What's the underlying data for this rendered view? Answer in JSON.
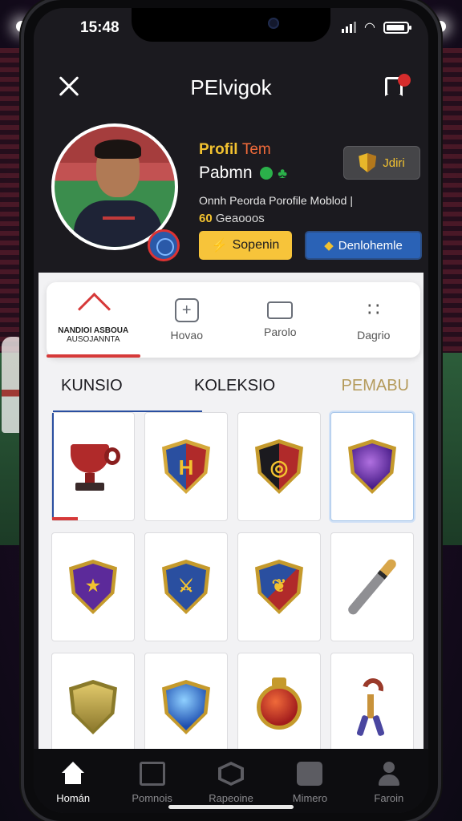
{
  "status_bar": {
    "time": "15:48"
  },
  "header": {
    "title": "PElvigok"
  },
  "profile": {
    "title_a": "Profil",
    "title_b": "Tem",
    "name": "Pabmn",
    "description": "Onnh Peorda Porofile Moblod |",
    "count_value": "60",
    "count_label": "Geaooos",
    "team_button": "Jdiri",
    "primary_button": "Sopenin",
    "secondary_button": "Denlohemle"
  },
  "tabs": [
    {
      "line1": "NANDIOI ASBOUA",
      "line2": "AUSOJANNTA",
      "icon": "house-icon"
    },
    {
      "label": "Hovao",
      "icon": "plus-box-icon"
    },
    {
      "label": "Parolo",
      "icon": "card-icon"
    },
    {
      "label": "Dagrio",
      "icon": "dots-icon"
    }
  ],
  "segments": [
    "KUNSIO",
    "KOLEKSIO",
    "PEMABU"
  ],
  "collection": [
    {
      "name": "red-cup-trophy"
    },
    {
      "name": "gold-h-shield"
    },
    {
      "name": "crest-shield"
    },
    {
      "name": "purple-orb-crest"
    },
    {
      "name": "purple-laurel-shield"
    },
    {
      "name": "blue-sword-shield"
    },
    {
      "name": "red-blue-shield"
    },
    {
      "name": "bronze-baton"
    },
    {
      "name": "gold-shield"
    },
    {
      "name": "blue-crystal-shield"
    },
    {
      "name": "red-orb-amulet"
    },
    {
      "name": "hook-staff"
    }
  ],
  "bottom_nav": [
    {
      "label": "Homán",
      "icon": "home-icon"
    },
    {
      "label": "Pomnois",
      "icon": "box-icon"
    },
    {
      "label": "Rapeoine",
      "icon": "hexagon-icon"
    },
    {
      "label": "Mimero",
      "icon": "bag-icon"
    },
    {
      "label": "Faroin",
      "icon": "user-icon"
    }
  ],
  "colors": {
    "accent_red": "#d63939",
    "gold": "#f2c230",
    "blue": "#2a62b6"
  }
}
